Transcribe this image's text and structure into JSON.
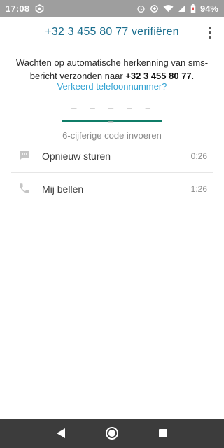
{
  "status_bar": {
    "time": "17:08",
    "battery": "94%",
    "icons": [
      "app-notification-icon",
      "alarm-icon",
      "data-saver-icon",
      "wifi-icon",
      "signal-icon",
      "battery-icon"
    ]
  },
  "header": {
    "title": "+32 3 455 80 77 verifiëren",
    "menu_icon": "more-vert-icon"
  },
  "instruction": {
    "text": "Wachten op automatische herkenning van sms-bericht verzonden naar ",
    "phone": "+32 3 455 80 77",
    "suffix": "."
  },
  "wrong_number_link": "Verkeerd telefoonnummer?",
  "code_input": {
    "placeholder": "– – –   – – –"
  },
  "code_hint": "6-cijferige code invoeren",
  "actions": [
    {
      "label": "Opnieuw sturen",
      "timer": "0:26",
      "icon": "message-icon"
    },
    {
      "label": "Mij bellen",
      "timer": "1:26",
      "icon": "phone-icon"
    }
  ],
  "nav_bar": {
    "icons": [
      "back-icon",
      "home-icon",
      "recents-icon"
    ]
  },
  "colors": {
    "accent_title": "#1c6f8f",
    "link": "#34a4d4",
    "input_underline": "#0f7d68",
    "status_bar": "#9e9e9e",
    "nav_bar": "#3c3c3c"
  }
}
